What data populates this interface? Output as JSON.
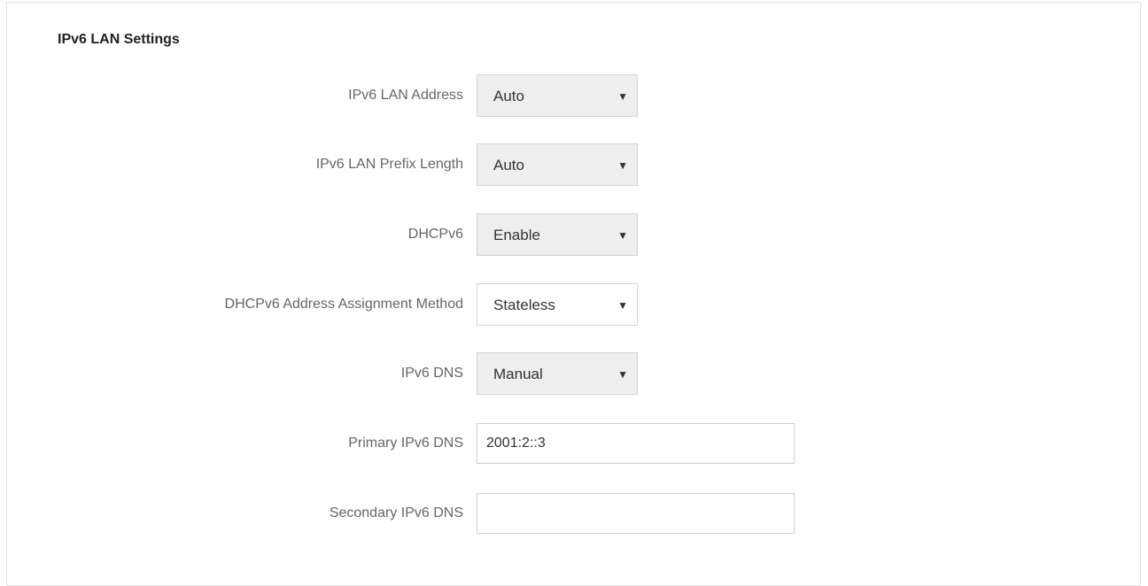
{
  "section": {
    "title": "IPv6 LAN Settings"
  },
  "fields": {
    "ipv6_lan_address": {
      "label": "IPv6 LAN Address",
      "value": "Auto",
      "arrow": "▼"
    },
    "ipv6_lan_prefix_length": {
      "label": "IPv6 LAN Prefix Length",
      "value": "Auto",
      "arrow": "▼"
    },
    "dhcpv6": {
      "label": "DHCPv6",
      "value": "Enable",
      "arrow": "▼"
    },
    "dhcpv6_assignment_method": {
      "label": "DHCPv6 Address Assignment Method",
      "value": "Stateless",
      "arrow": "▼"
    },
    "ipv6_dns": {
      "label": "IPv6 DNS",
      "value": "Manual",
      "arrow": "▼"
    },
    "primary_ipv6_dns": {
      "label": "Primary IPv6 DNS",
      "value": "2001:2::3",
      "placeholder": ""
    },
    "secondary_ipv6_dns": {
      "label": "Secondary IPv6 DNS",
      "value": "",
      "placeholder": ""
    }
  },
  "colors": {
    "select_background": "#eeeeee",
    "label_text": "#666666",
    "title_text": "#222222",
    "border": "#d4d4d4"
  }
}
